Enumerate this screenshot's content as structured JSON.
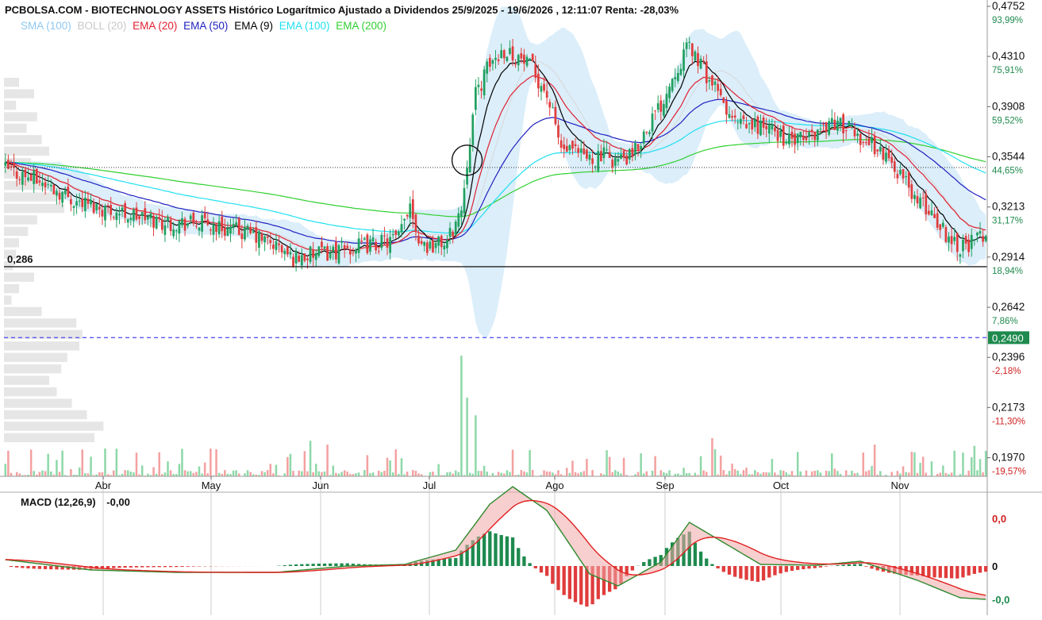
{
  "header": {
    "title": "PCBOLSA.COM - BIOTECHNOLOGY ASSETS Histórico Logarítmico Ajustado a Dividendos 25/9/2025 - 19/6/2026 , 12:11:07 Renta: -28,03%"
  },
  "legend": [
    {
      "label": "SMA (100)",
      "color": "#90c8f0"
    },
    {
      "label": "BOLL (20)",
      "color": "#c8c8c8"
    },
    {
      "label": "EMA (20)",
      "color": "#e02030"
    },
    {
      "label": "EMA (50)",
      "color": "#2020c0"
    },
    {
      "label": "EMA (9)",
      "color": "#000000"
    },
    {
      "label": "EMA (100)",
      "color": "#20e0f0"
    },
    {
      "label": "EMA (200)",
      "color": "#30d030"
    }
  ],
  "reference": {
    "support_label": "0,286",
    "last_price_label": "0,2490"
  },
  "price_axis": [
    {
      "price": "0,4752",
      "pct": "93,99%"
    },
    {
      "price": "0,4310",
      "pct": "75,91%"
    },
    {
      "price": "0,3908",
      "pct": "59,52%"
    },
    {
      "price": "0,3544",
      "pct": "44,65%"
    },
    {
      "price": "0,3213",
      "pct": "31,17%"
    },
    {
      "price": "0,2914",
      "pct": "18,94%"
    },
    {
      "price": "0,2642",
      "pct": "7,86%"
    },
    {
      "price": "0,2396",
      "pct": "-2,18%"
    },
    {
      "price": "0,2173",
      "pct": "-11,30%"
    },
    {
      "price": "0,1970",
      "pct": "-19,57%"
    }
  ],
  "months": [
    "Abr",
    "May",
    "Jun",
    "Jul",
    "Ago",
    "Sep",
    "Oct",
    "Nov"
  ],
  "macd": {
    "label": "MACD (12,26,9)",
    "value": "-0,00",
    "axis": [
      "0,0",
      "0",
      "-0,0"
    ]
  },
  "colors": {
    "up": "#20a060",
    "down": "#e03c3c",
    "volume_up": "#8ed8a8",
    "volume_down": "#f4a0a0",
    "boll_fill": "#dbeefa",
    "last_price_line": "#5a5af0",
    "last_price_badge": "#1e8a4e"
  },
  "chart_data": {
    "type": "candlestick",
    "scale": "log",
    "ylim": [
      0.19,
      0.4752
    ],
    "reference_lines": {
      "support": 0.286,
      "last_price": 0.249,
      "dotted": 0.347
    },
    "anchor_dates": [
      "2025-09-25",
      "2026-06-19"
    ],
    "price_path": [
      [
        0,
        0.346
      ],
      [
        12,
        0.338
      ],
      [
        25,
        0.325
      ],
      [
        40,
        0.318
      ],
      [
        55,
        0.312
      ],
      [
        70,
        0.311
      ],
      [
        85,
        0.305
      ],
      [
        95,
        0.298
      ],
      [
        100,
        0.291
      ],
      [
        110,
        0.293
      ],
      [
        120,
        0.296
      ],
      [
        130,
        0.299
      ],
      [
        138,
        0.302
      ],
      [
        142,
        0.325
      ],
      [
        145,
        0.302
      ],
      [
        148,
        0.298
      ],
      [
        155,
        0.3
      ],
      [
        160,
        0.32
      ],
      [
        165,
        0.4
      ],
      [
        170,
        0.425
      ],
      [
        175,
        0.437
      ],
      [
        180,
        0.43
      ],
      [
        185,
        0.42
      ],
      [
        190,
        0.4
      ],
      [
        195,
        0.36
      ],
      [
        200,
        0.356
      ],
      [
        205,
        0.353
      ],
      [
        210,
        0.355
      ],
      [
        215,
        0.352
      ],
      [
        220,
        0.354
      ],
      [
        225,
        0.375
      ],
      [
        230,
        0.392
      ],
      [
        235,
        0.42
      ],
      [
        240,
        0.44
      ],
      [
        245,
        0.42
      ],
      [
        250,
        0.4
      ],
      [
        255,
        0.38
      ],
      [
        260,
        0.375
      ],
      [
        265,
        0.377
      ],
      [
        270,
        0.372
      ],
      [
        275,
        0.365
      ],
      [
        280,
        0.366
      ],
      [
        285,
        0.373
      ],
      [
        290,
        0.38
      ],
      [
        295,
        0.375
      ],
      [
        300,
        0.368
      ],
      [
        305,
        0.362
      ],
      [
        310,
        0.352
      ],
      [
        315,
        0.34
      ],
      [
        320,
        0.325
      ],
      [
        325,
        0.318
      ],
      [
        330,
        0.305
      ],
      [
        335,
        0.298
      ],
      [
        340,
        0.3
      ],
      [
        344,
        0.306
      ]
    ],
    "volume_spikes": [
      [
        160,
        0.95
      ],
      [
        162,
        0.62
      ],
      [
        165,
        0.48
      ],
      [
        107,
        0.28
      ],
      [
        113,
        0.25
      ],
      [
        248,
        0.3
      ],
      [
        305,
        0.25
      ],
      [
        340,
        0.24
      ],
      [
        344,
        0.2
      ]
    ],
    "volume_profile": [
      0.1,
      0.2,
      0.08,
      0.22,
      0.15,
      0.25,
      0.3,
      0.18,
      0.12,
      0.28,
      0.35,
      0.4,
      0.22,
      0.16,
      0.1,
      0.08,
      0.06,
      0.2,
      0.1,
      0.05,
      0.25,
      0.48,
      0.52,
      0.5,
      0.42,
      0.38,
      0.3,
      0.35,
      0.45,
      0.55,
      0.66,
      0.6
    ],
    "macd_path": [
      [
        0,
        0.08
      ],
      [
        30,
        -0.05
      ],
      [
        60,
        -0.08
      ],
      [
        95,
        -0.08
      ],
      [
        120,
        0.0
      ],
      [
        140,
        0.02
      ],
      [
        158,
        0.2
      ],
      [
        170,
        0.78
      ],
      [
        178,
        1.0
      ],
      [
        190,
        0.7
      ],
      [
        205,
        -0.1
      ],
      [
        215,
        -0.25
      ],
      [
        230,
        0.05
      ],
      [
        240,
        0.55
      ],
      [
        248,
        0.38
      ],
      [
        265,
        0.02
      ],
      [
        285,
        0.01
      ],
      [
        300,
        0.06
      ],
      [
        320,
        -0.18
      ],
      [
        335,
        -0.4
      ],
      [
        344,
        -0.42
      ]
    ]
  }
}
